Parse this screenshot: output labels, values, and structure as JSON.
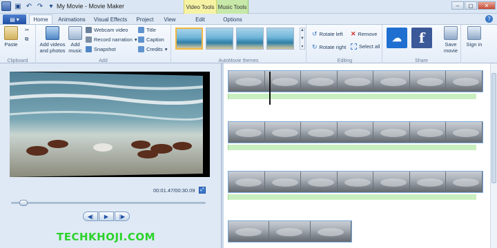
{
  "window": {
    "title": "My Movie - Movie Maker",
    "context_tabs": [
      "Video Tools",
      "Music Tools"
    ]
  },
  "tabs": {
    "file": "▾",
    "items": [
      "Home",
      "Animations",
      "Visual Effects",
      "Project",
      "View",
      "Edit",
      "Options"
    ],
    "active": "Home"
  },
  "ribbon": {
    "clipboard": {
      "label": "Clipboard",
      "paste": "Paste"
    },
    "add": {
      "label": "Add",
      "add_videos": "Add videos and photos",
      "add_music": "Add music",
      "webcam": "Webcam video",
      "narration": "Record narration",
      "snapshot": "Snapshot",
      "title": "Title",
      "caption": "Caption",
      "credits": "Credits"
    },
    "themes": {
      "label": "AutoMovie themes"
    },
    "editing": {
      "label": "Editing",
      "rotate_left": "Rotate left",
      "rotate_right": "Rotate right",
      "remove": "Remove",
      "select_all": "Select all"
    },
    "share": {
      "label": "Share",
      "save_movie": "Save movie",
      "sign_in": "Sign in"
    }
  },
  "preview": {
    "timecode": "00:01.47/00:30.09",
    "watermark": "TECHKHOJI.COM"
  },
  "colors": {
    "accent": "#1f4fa3",
    "audio_track": "#c9efc0",
    "watermark": "#2bd32b"
  }
}
